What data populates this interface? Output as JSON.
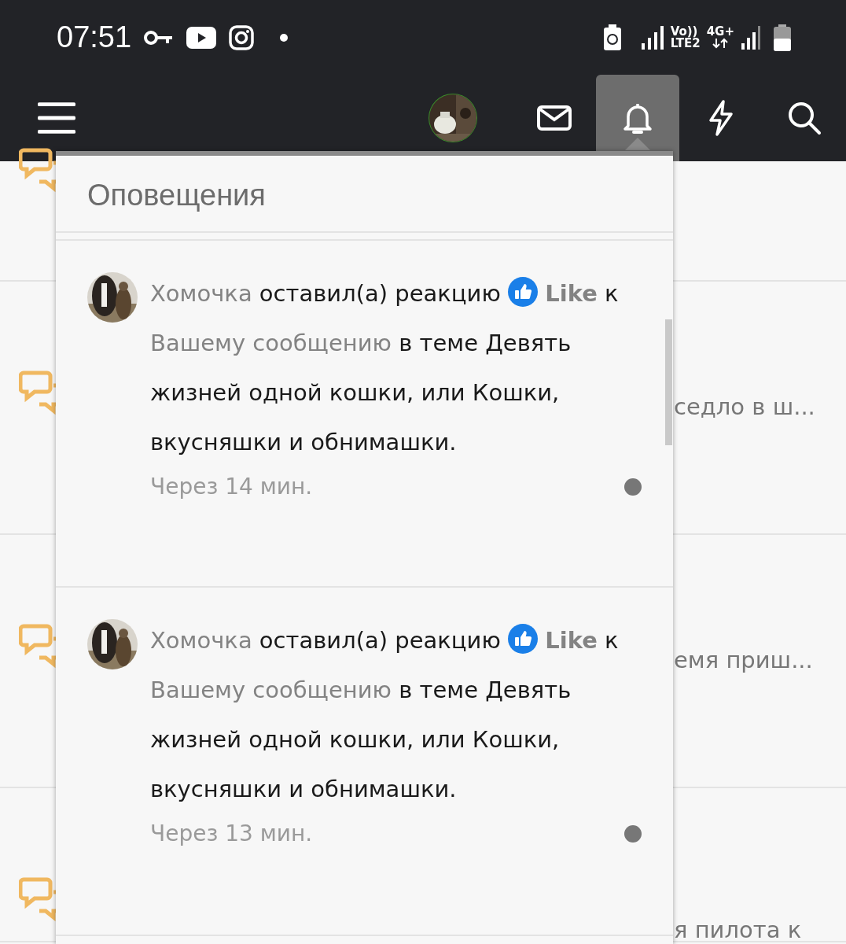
{
  "status_bar": {
    "time": "07:51",
    "volte_top": "Vo))",
    "volte_bottom": "LTE2",
    "network": "4G+"
  },
  "navbar": {
    "alerts_selected": true
  },
  "notifications": {
    "title": "Оповещения",
    "items": [
      {
        "user": "Хомочка",
        "action": "оставил(а) реакцию",
        "reaction": "Like",
        "preposition": "к",
        "link": "Вашему сообщению",
        "rest": "в теме Девять жизней одной кошки, или Кошки, вкусняшки и обнимашки.",
        "time": "Через 14 мин.",
        "unread": true
      },
      {
        "user": "Хомочка",
        "action": "оставил(а) реакцию",
        "reaction": "Like",
        "preposition": "к",
        "link": "Вашему сообщению",
        "rest": "в теме Девять жизней одной кошки, или Кошки, вкусняшки и обнимашки.",
        "time": "Через 13 мин.",
        "unread": true
      }
    ]
  },
  "background_threads": [
    {
      "snippet": "седло в ш..."
    },
    {
      "snippet": "емя приш..."
    },
    {
      "snippet": "я пилота к"
    }
  ]
}
